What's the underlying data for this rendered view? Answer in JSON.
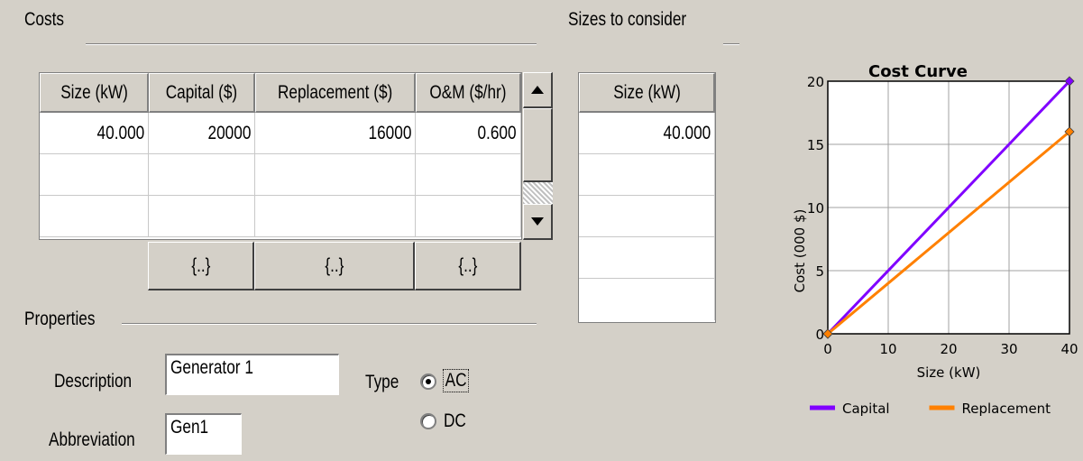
{
  "costs": {
    "title": "Costs",
    "columns": [
      "Size (kW)",
      "Capital ($)",
      "Replacement ($)",
      "O&M ($/hr)"
    ],
    "rows": [
      [
        "40.000",
        "20000",
        "16000",
        "0.600"
      ],
      [
        "",
        "",
        "",
        ""
      ],
      [
        "",
        "",
        "",
        ""
      ]
    ],
    "lookup_label": "{..}"
  },
  "sizes": {
    "title": "Sizes to consider",
    "column": "Size (kW)",
    "rows": [
      "40.000",
      "",
      "",
      "",
      ""
    ]
  },
  "properties": {
    "title": "Properties",
    "description_label": "Description",
    "description_value": "Generator 1",
    "abbreviation_label": "Abbreviation",
    "abbreviation_value": "Gen1",
    "type_label": "Type",
    "type_options": [
      "AC",
      "DC"
    ],
    "type_selected": "AC"
  },
  "chart_data": {
    "type": "line",
    "title": "Cost Curve",
    "xlabel": "Size (kW)",
    "ylabel": "Cost (000 $)",
    "xlim": [
      0,
      40
    ],
    "ylim": [
      0,
      20
    ],
    "xticks": [
      0,
      10,
      20,
      30,
      40
    ],
    "yticks": [
      0,
      5,
      10,
      15,
      20
    ],
    "grid": true,
    "legend_position": "bottom",
    "series": [
      {
        "name": "Capital",
        "color": "#8000ff",
        "x": [
          0,
          40
        ],
        "y": [
          0,
          20
        ]
      },
      {
        "name": "Replacement",
        "color": "#ff8000",
        "x": [
          0,
          40
        ],
        "y": [
          0,
          16
        ]
      }
    ]
  }
}
